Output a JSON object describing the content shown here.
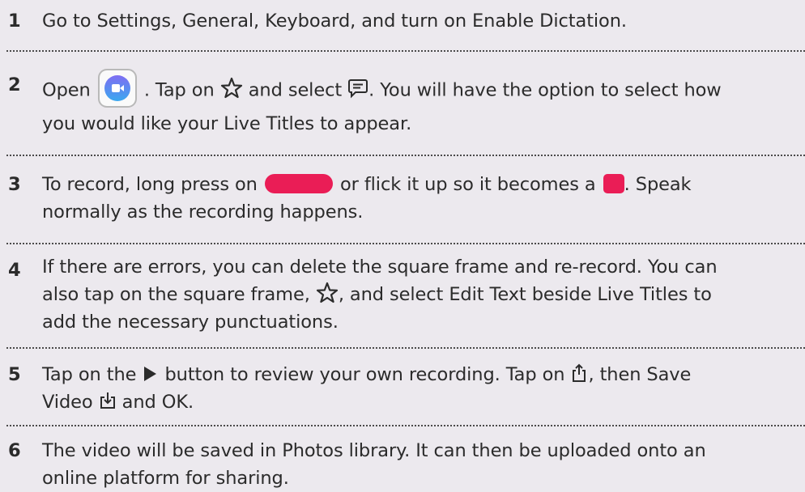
{
  "steps": [
    {
      "number": "1",
      "text": "Go to Settings, General, Keyboard, and turn on Enable Dictation."
    },
    {
      "number": "2",
      "parts": [
        "Open",
        ". Tap on",
        "and select",
        ". You will have the option to select how",
        "you would like your Live Titles to appear."
      ]
    },
    {
      "number": "3",
      "parts": [
        "To record, long press on",
        "or flick it up so it becomes a",
        ". Speak",
        "normally as the recording happens."
      ]
    },
    {
      "number": "4",
      "parts": [
        "If there are errors, you can delete the square frame and re-record. You can",
        "also tap on the square frame,",
        ", and select Edit Text beside Live Titles to",
        "add the necessary punctuations."
      ]
    },
    {
      "number": "5",
      "parts": [
        "Tap on the",
        "button to review your own recording. Tap on",
        ", then Save",
        "Video",
        "and OK."
      ]
    },
    {
      "number": "6",
      "parts": [
        "The video will be saved in Photos library. It can then be uploaded onto an",
        "online platform for sharing."
      ]
    }
  ],
  "icons": {
    "app": "clips-app-icon",
    "star": "star-icon",
    "live_titles": "speech-bubble-icon",
    "record": "record-pill-icon",
    "recording": "record-square-icon",
    "play": "play-icon",
    "share": "share-icon",
    "save": "save-download-icon"
  },
  "colors": {
    "background": "#ece9ee",
    "record_red": "#ea1d56",
    "text": "#2b2b2b"
  }
}
